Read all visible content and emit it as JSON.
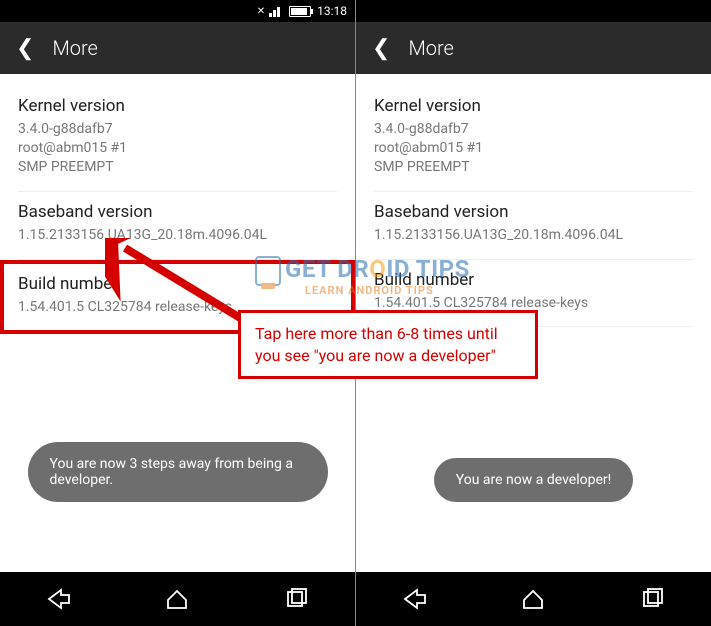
{
  "status": {
    "time": "13:18"
  },
  "header": {
    "title": "More"
  },
  "sections": {
    "kernel": {
      "title": "Kernel version",
      "value": "3.4.0-g88dafb7\nroot@abm015 #1\nSMP PREEMPT"
    },
    "baseband": {
      "title": "Baseband version",
      "value": "1.15.2133156.UA13G_20.18m.4096.04L"
    },
    "build": {
      "title": "Build number",
      "value": "1.54.401.5 CL325784 release-keys"
    }
  },
  "toasts": {
    "left": "You are now 3 steps away from being a developer.",
    "right": "You are now a developer!"
  },
  "annotation": {
    "text": "Tap here more than 6-8 times until you see \"you are now a developer\""
  },
  "watermark": {
    "line1_pre": "GET DR",
    "line1_o": "O",
    "line1_post": "ID TIPS",
    "line2": "LEARN ANDROID TIPS"
  }
}
